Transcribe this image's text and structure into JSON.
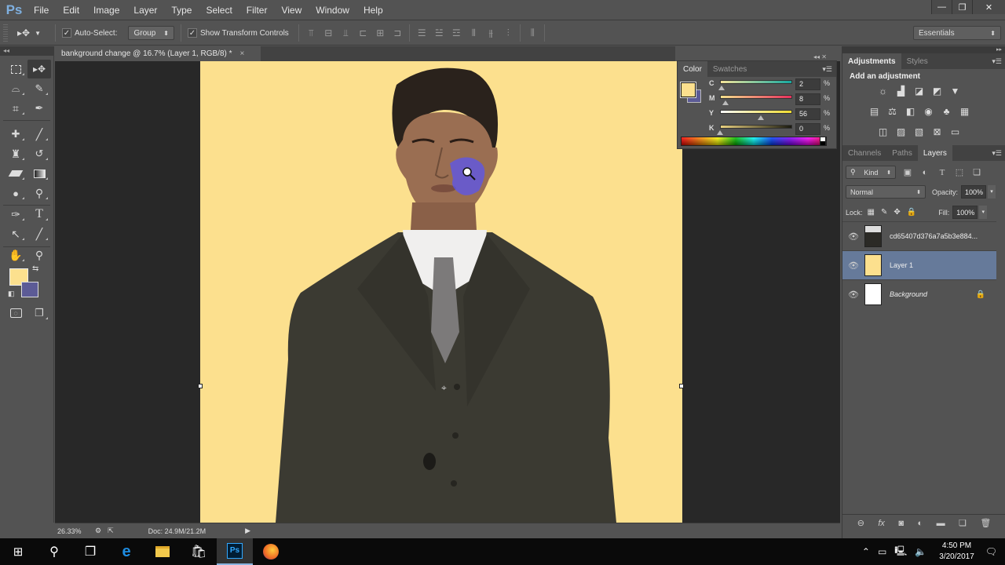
{
  "app": {
    "logo": "Ps",
    "menu": [
      "File",
      "Edit",
      "Image",
      "Layer",
      "Type",
      "Select",
      "Filter",
      "View",
      "Window",
      "Help"
    ],
    "window_controls": {
      "minimize": "—",
      "restore": "❐",
      "close": "✕"
    }
  },
  "options_bar": {
    "tool_icon": "move-tool-icon",
    "auto_select_label": "Auto-Select:",
    "auto_select_checked": true,
    "auto_select_mode": "Group",
    "show_transform_label": "Show Transform Controls",
    "show_transform_checked": true,
    "workspace": "Essentials"
  },
  "document": {
    "tab_title": "bankground change @ 16.7% (Layer 1, RGB/8) *",
    "close": "×",
    "canvas_color": "#fce08e"
  },
  "tools": {
    "header": "◂◂",
    "foreground_color": "#fce08e",
    "background_color": "#5c5b96",
    "items": [
      {
        "name": "rectangular-marquee",
        "glyph": "⬚"
      },
      {
        "name": "move",
        "glyph": "▸✥",
        "active": true
      },
      {
        "name": "lasso",
        "glyph": "ᗡ"
      },
      {
        "name": "quick-selection",
        "glyph": "✎"
      },
      {
        "name": "crop",
        "glyph": "⌗"
      },
      {
        "name": "eyedropper",
        "glyph": "✒"
      },
      {
        "name": "spot-healing",
        "glyph": "✚"
      },
      {
        "name": "brush",
        "glyph": "🖌"
      },
      {
        "name": "clone-stamp",
        "glyph": "♜"
      },
      {
        "name": "history-brush",
        "glyph": "↺"
      },
      {
        "name": "eraser",
        "glyph": "▱"
      },
      {
        "name": "gradient",
        "glyph": "▬"
      },
      {
        "name": "blur",
        "glyph": "💧"
      },
      {
        "name": "dodge",
        "glyph": "⚲"
      },
      {
        "name": "pen",
        "glyph": "✑"
      },
      {
        "name": "type",
        "glyph": "T"
      },
      {
        "name": "path-selection",
        "glyph": "↖"
      },
      {
        "name": "line",
        "glyph": "╱"
      },
      {
        "name": "hand",
        "glyph": "✋"
      },
      {
        "name": "zoom",
        "glyph": "🔍"
      }
    ],
    "bottom": [
      {
        "name": "quick-mask",
        "glyph": "◙"
      },
      {
        "name": "screen-mode",
        "glyph": "❐"
      }
    ]
  },
  "status_bar": {
    "zoom": "26.33%",
    "doc_info": "Doc: 24.9M/21.2M",
    "arrow": "▶"
  },
  "color_panel": {
    "tabs": [
      "Color",
      "Swatches"
    ],
    "active_tab": "Color",
    "foreground": "#fce08e",
    "background": "#5c5b96",
    "channels": [
      {
        "label": "C",
        "value": "2",
        "fraction": 0.02,
        "gradient": "linear-gradient(to right,#f4e49a,#16a9a0)"
      },
      {
        "label": "M",
        "value": "8",
        "fraction": 0.08,
        "gradient": "linear-gradient(to right,#f2e08c,#e8305c)"
      },
      {
        "label": "Y",
        "value": "56",
        "fraction": 0.56,
        "gradient": "linear-gradient(to right,#fafafa,#f0dc30)"
      },
      {
        "label": "K",
        "value": "0",
        "fraction": 0.0,
        "gradient": "linear-gradient(to right,#e8d080,#1a1a10)"
      }
    ],
    "unit": "%"
  },
  "adjustments_panel": {
    "tabs": [
      "Adjustments",
      "Styles"
    ],
    "active_tab": "Adjustments",
    "title": "Add an adjustment",
    "rows": [
      [
        {
          "name": "brightness-contrast",
          "glyph": "☼"
        },
        {
          "name": "levels",
          "glyph": "▙"
        },
        {
          "name": "curves",
          "glyph": "◪"
        },
        {
          "name": "exposure",
          "glyph": "◩"
        },
        {
          "name": "vibrance",
          "glyph": "▼"
        }
      ],
      [
        {
          "name": "hue-saturation",
          "glyph": "▦"
        },
        {
          "name": "color-balance",
          "glyph": "⚖"
        },
        {
          "name": "black-white",
          "glyph": "◧"
        },
        {
          "name": "photo-filter",
          "glyph": "◉"
        },
        {
          "name": "channel-mixer",
          "glyph": "♣"
        },
        {
          "name": "color-lookup",
          "glyph": "▦"
        }
      ],
      [
        {
          "name": "invert",
          "glyph": "◫"
        },
        {
          "name": "posterize",
          "glyph": "▨"
        },
        {
          "name": "threshold",
          "glyph": "▧"
        },
        {
          "name": "selective-color",
          "glyph": "⊠"
        },
        {
          "name": "gradient-map",
          "glyph": "▭"
        }
      ]
    ]
  },
  "layers_panel": {
    "tabs": [
      "Channels",
      "Paths",
      "Layers"
    ],
    "active_tab": "Layers",
    "filter_kind": "Kind",
    "blend_mode": "Normal",
    "opacity_label": "Opacity:",
    "opacity": "100%",
    "lock_label": "Lock:",
    "fill_label": "Fill:",
    "fill": "100%",
    "layers": [
      {
        "name": "cd65407d376a7a5b3e884...",
        "visible": true,
        "selected": false,
        "thumb": "photo",
        "italic": false,
        "locked": false
      },
      {
        "name": "Layer 1",
        "visible": true,
        "selected": true,
        "thumb": "#fce08e",
        "italic": false,
        "locked": false
      },
      {
        "name": "Background",
        "visible": true,
        "selected": false,
        "thumb": "#ffffff",
        "italic": true,
        "locked": true
      }
    ],
    "footer_icons": [
      "link-icon",
      "fx-icon",
      "mask-icon",
      "adjustment-layer-icon",
      "group-icon",
      "new-layer-icon",
      "trash-icon"
    ]
  },
  "taskbar": {
    "apps": [
      "start",
      "search",
      "task-view",
      "edge",
      "file-explorer",
      "store",
      "photoshop",
      "firefox"
    ],
    "active_app": "photoshop",
    "time": "4:50 PM",
    "date": "3/20/2017"
  }
}
